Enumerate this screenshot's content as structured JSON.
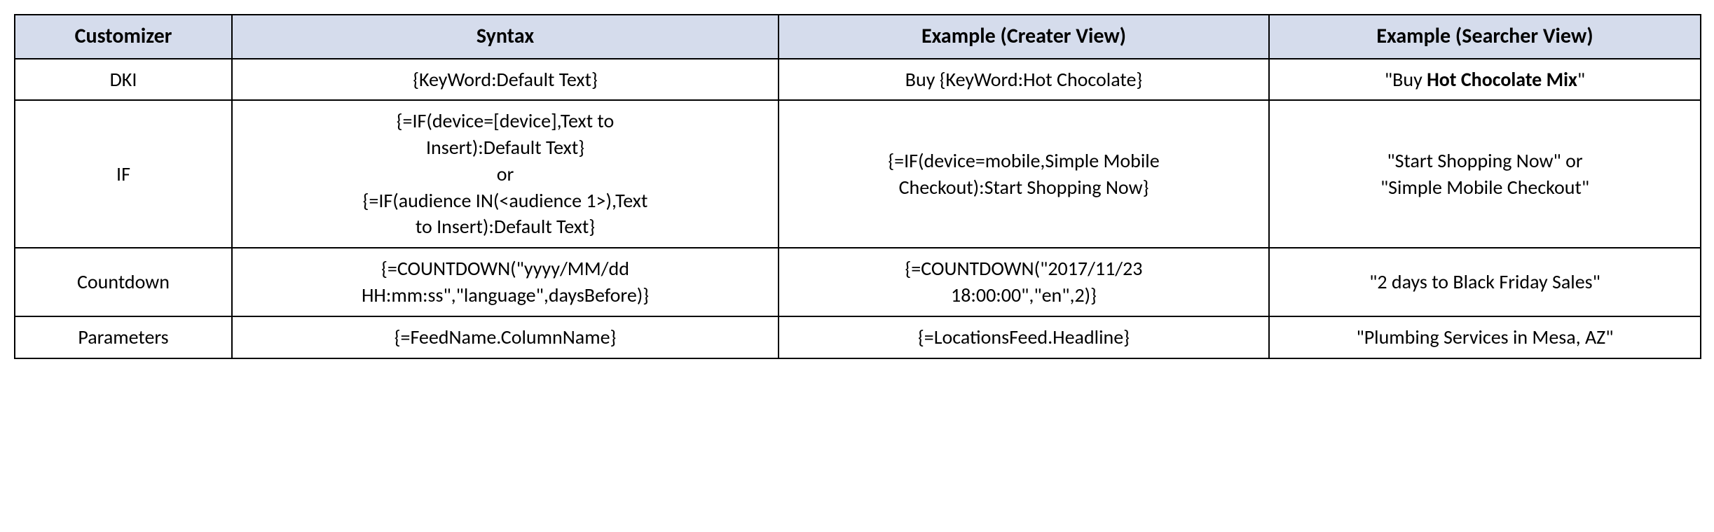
{
  "headers": {
    "customizer": "Customizer",
    "syntax": "Syntax",
    "creator": "Example (Creater View)",
    "searcher": "Example (Searcher View)"
  },
  "rows": {
    "dki": {
      "label": "DKI",
      "syntax": "{KeyWord:Default Text}",
      "creator": "Buy {KeyWord:Hot Chocolate}",
      "searcher_prefix": "\"Buy ",
      "searcher_bold": "Hot Chocolate Mix",
      "searcher_suffix": "\""
    },
    "if": {
      "label": "IF",
      "syntax_line1": "{=IF(device=[device],Text to",
      "syntax_line2": "Insert):Default Text}",
      "syntax_line3": "or",
      "syntax_line4": "{=IF(audience IN(<audience 1>),Text",
      "syntax_line5": "to Insert):Default Text}",
      "creator_line1": "{=IF(device=mobile,Simple Mobile",
      "creator_line2": "Checkout):Start Shopping Now}",
      "searcher_line1": "\"Start Shopping Now\" or",
      "searcher_line2": "\"Simple Mobile Checkout\""
    },
    "countdown": {
      "label": "Countdown",
      "syntax_line1": "{=COUNTDOWN(\"yyyy/MM/dd",
      "syntax_line2": "HH:mm:ss\",\"language\",daysBefore)}",
      "creator_line1": "{=COUNTDOWN(\"2017/11/23",
      "creator_line2": "18:00:00\",\"en\",2)}",
      "searcher": "\"2 days to Black Friday Sales\""
    },
    "parameters": {
      "label": "Parameters",
      "syntax": "{=FeedName.ColumnName}",
      "creator": "{=LocationsFeed.Headline}",
      "searcher": "\"Plumbing Services in Mesa, AZ\""
    }
  }
}
